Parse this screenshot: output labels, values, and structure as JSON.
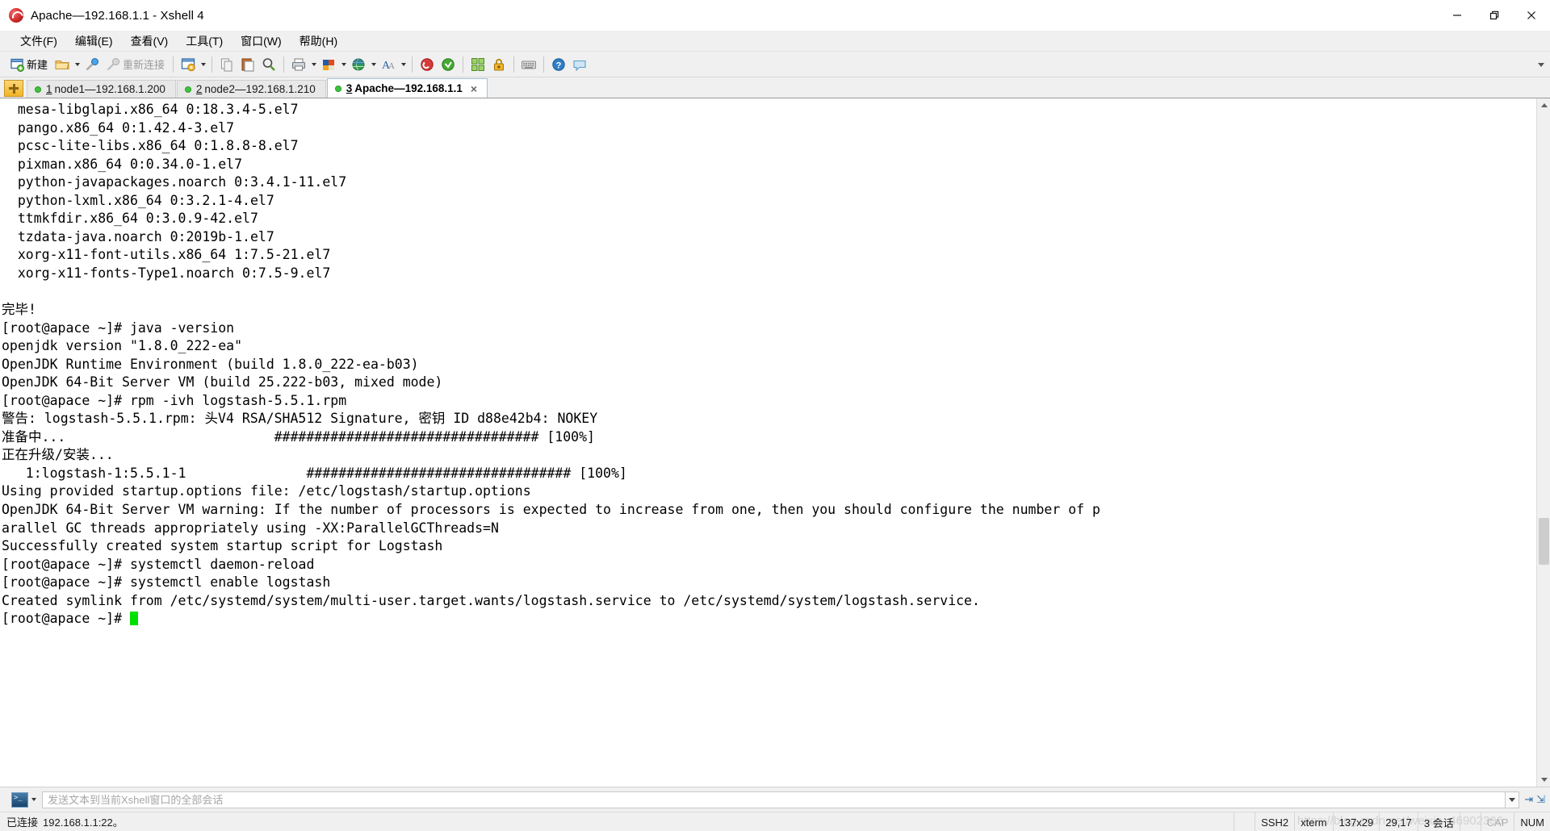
{
  "window": {
    "title": "Apache—192.168.1.1 - Xshell 4",
    "app_icon": "xshell-logo-icon",
    "controls": [
      {
        "name": "minimize-button",
        "glyph": "minimize-icon"
      },
      {
        "name": "restore-button",
        "glyph": "restore-icon"
      },
      {
        "name": "close-button",
        "glyph": "close-icon"
      }
    ]
  },
  "menubar": {
    "items": [
      {
        "label": "文件(F)",
        "name": "menu-file"
      },
      {
        "label": "编辑(E)",
        "name": "menu-edit"
      },
      {
        "label": "查看(V)",
        "name": "menu-view"
      },
      {
        "label": "工具(T)",
        "name": "menu-tools"
      },
      {
        "label": "窗口(W)",
        "name": "menu-window"
      },
      {
        "label": "帮助(H)",
        "name": "menu-help"
      }
    ]
  },
  "toolbar": {
    "new_label": "新建",
    "reconnect_label": "重新连接",
    "icons": [
      "new-session-icon",
      "open-folder-icon",
      "open-dropdown-arrow",
      "connect-icon",
      "disconnect-icon",
      "session-manager-icon",
      "session-dropdown-arrow",
      "copy-icon",
      "paste-icon",
      "find-icon",
      "print-icon",
      "print-dropdown-arrow",
      "color-scheme-icon",
      "color-dropdown-arrow",
      "globe-icon",
      "globe-dropdown-arrow",
      "font-icon",
      "font-dropdown-arrow",
      "xshell-icon",
      "xftp-icon",
      "arrange-icon",
      "lock-icon",
      "keyboard-icon",
      "help-icon",
      "chat-icon"
    ],
    "overflow_arrow": "toolbar-overflow-icon"
  },
  "tabs": {
    "new_tab_button": "new-tab-button",
    "items": [
      {
        "index": "1",
        "title": "node1—192.168.1.200",
        "active": false,
        "status": "connected"
      },
      {
        "index": "2",
        "title": "node2—192.168.1.210",
        "active": false,
        "status": "connected"
      },
      {
        "index": "3",
        "title": "Apache—192.168.1.1",
        "active": true,
        "status": "connected",
        "close": "×"
      }
    ]
  },
  "terminal": {
    "lines": [
      "  mesa-libglapi.x86_64 0:18.3.4-5.el7",
      "  pango.x86_64 0:1.42.4-3.el7",
      "  pcsc-lite-libs.x86_64 0:1.8.8-8.el7",
      "  pixman.x86_64 0:0.34.0-1.el7",
      "  python-javapackages.noarch 0:3.4.1-11.el7",
      "  python-lxml.x86_64 0:3.2.1-4.el7",
      "  ttmkfdir.x86_64 0:3.0.9-42.el7",
      "  tzdata-java.noarch 0:2019b-1.el7",
      "  xorg-x11-font-utils.x86_64 1:7.5-21.el7",
      "  xorg-x11-fonts-Type1.noarch 0:7.5-9.el7",
      "",
      "完毕!",
      "[root@apace ~]# java -version",
      "openjdk version \"1.8.0_222-ea\"",
      "OpenJDK Runtime Environment (build 1.8.0_222-ea-b03)",
      "OpenJDK 64-Bit Server VM (build 25.222-b03, mixed mode)",
      "[root@apace ~]# rpm -ivh logstash-5.5.1.rpm",
      "警告: logstash-5.5.1.rpm: 头V4 RSA/SHA512 Signature, 密钥 ID d88e42b4: NOKEY",
      "准备中...                          ################################# [100%]",
      "正在升级/安装...",
      "   1:logstash-1:5.5.1-1               ################################# [100%]",
      "Using provided startup.options file: /etc/logstash/startup.options",
      "OpenJDK 64-Bit Server VM warning: If the number of processors is expected to increase from one, then you should configure the number of p",
      "arallel GC threads appropriately using -XX:ParallelGCThreads=N",
      "Successfully created system startup script for Logstash",
      "[root@apace ~]# systemctl daemon-reload",
      "[root@apace ~]# systemctl enable logstash",
      "Created symlink from /etc/systemd/system/multi-user.target.wants/logstash.service to /etc/systemd/system/logstash.service.",
      "[root@apace ~]# "
    ],
    "cursor_visible": true,
    "cursor_color": "#00e000",
    "foreground": "#000000",
    "background": "#ffffff"
  },
  "scrollbar": {
    "up_arrow": "scroll-up-icon",
    "down_arrow": "scroll-down-icon",
    "thumb": "scroll-thumb"
  },
  "sendbar": {
    "icon": "send-to-all-sessions-icon",
    "dropdown": "send-target-dropdown",
    "placeholder": "发送文本到当前Xshell窗口的全部会话",
    "value": "",
    "combo_arrow": "history-dropdown-icon",
    "send_arrow": "send-arrow-icon",
    "expand_arrow": "expand-arrow-icon"
  },
  "statusbar": {
    "connection_label": "已连接",
    "connection_value": "192.168.1.1:22。",
    "cells": [
      {
        "text": "SSH2",
        "name": "status-protocol"
      },
      {
        "text": "xterm",
        "name": "status-terminal-type"
      },
      {
        "text": "137x29",
        "name": "status-dimensions"
      },
      {
        "text": "29,17",
        "name": "status-cursor-position"
      },
      {
        "text": "3 会话",
        "name": "status-session-count"
      },
      {
        "text": "",
        "name": "status-spacer"
      },
      {
        "text": "CAP",
        "name": "status-caps-lock",
        "muted": true
      },
      {
        "text": "NUM",
        "name": "status-num-lock",
        "muted": false
      }
    ],
    "watermark": "https://blog.csdn.net/weixin_46902306"
  },
  "colors": {
    "accent": "#2f6fa8",
    "tab_active_bg": "#ffffff",
    "chrome_bg": "#f0f0f0",
    "cursor_green": "#00e000",
    "status_dot": "#3fc33f"
  }
}
